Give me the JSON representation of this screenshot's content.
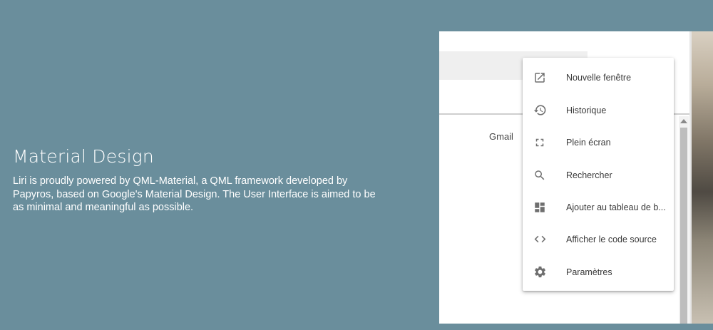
{
  "hero": {
    "title": "Material Design",
    "description": "Liri is proudly powered by QML-Material, a QML framework developed by Papyros, based on Google's Material Design. The User Interface is aimed to be as minimal and meaningful as possible."
  },
  "browser": {
    "gmail_link": "Gmail"
  },
  "menu": {
    "items": [
      {
        "label": "Nouvelle fenêtre",
        "icon": "open-in-new-icon"
      },
      {
        "label": "Historique",
        "icon": "history-icon"
      },
      {
        "label": "Plein écran",
        "icon": "fullscreen-icon"
      },
      {
        "label": "Rechercher",
        "icon": "search-icon"
      },
      {
        "label": "Ajouter au tableau de b...",
        "icon": "dashboard-icon"
      },
      {
        "label": "Afficher le code source",
        "icon": "code-icon"
      },
      {
        "label": "Paramètres",
        "icon": "settings-icon"
      }
    ]
  },
  "colors": {
    "background": "#6a8e9c",
    "icon": "#6f6f6f"
  }
}
